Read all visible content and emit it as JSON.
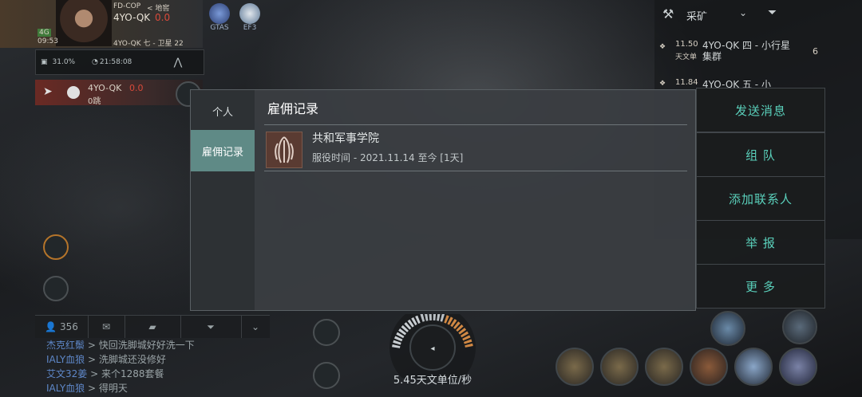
{
  "character": {
    "corp_tag": "FD-COP",
    "location_tag": "< 地窖",
    "system": "4YO-QK",
    "security": "0.0",
    "time": "09:53",
    "signal": "4G",
    "current_location": "4YO-QK 七 - 卫星 22",
    "corp_icons": [
      {
        "label": "GTAS",
        "icon": "gtas-corp-icon"
      },
      {
        "label": "EF3",
        "icon": "ef3-alliance-icon"
      }
    ]
  },
  "status": {
    "cargo_percent": "31.0%",
    "timer": "21:58:08"
  },
  "route": {
    "destination": "4YO-QK",
    "security": "0.0",
    "jumps": "0跳"
  },
  "overview": {
    "filter": "采矿",
    "rows": [
      {
        "distance": "11.50",
        "unit": "天文单",
        "name": "4YO-QK 四 - 小行星集群",
        "count": "6"
      },
      {
        "distance": "11.84",
        "unit": "",
        "name": "4YO-QK 五 - 小",
        "count": ""
      }
    ]
  },
  "modal": {
    "tabs": [
      {
        "label": "个人",
        "active": false
      },
      {
        "label": "雇佣记录",
        "active": true
      }
    ],
    "title": "雇佣记录",
    "entries": [
      {
        "corp": "共和军事学院",
        "service": "服役时间 - 2021.11.14 至今 [1天]"
      }
    ]
  },
  "actions": [
    "发送消息",
    "组 队",
    "添加联系人",
    "举 报",
    "更 多"
  ],
  "chat": {
    "member_count": "356",
    "messages": [
      {
        "name": "杰克红鬃",
        "text": " > 快回洗脚城好好洗一下"
      },
      {
        "name": "IALY血狼",
        "text": " > 洗脚城还没修好"
      },
      {
        "name": "艾文32姜",
        "text": " > 来个1288套餐"
      },
      {
        "name": "IALY血狼",
        "text": " > 得明天"
      }
    ]
  },
  "ship": {
    "speed": "5.45天文单位/秒"
  },
  "colors": {
    "accent": "#5ad0bb",
    "active_tab": "#5f8a86",
    "security_red": "#d84a3a",
    "chat_name": "#5e87c8"
  }
}
